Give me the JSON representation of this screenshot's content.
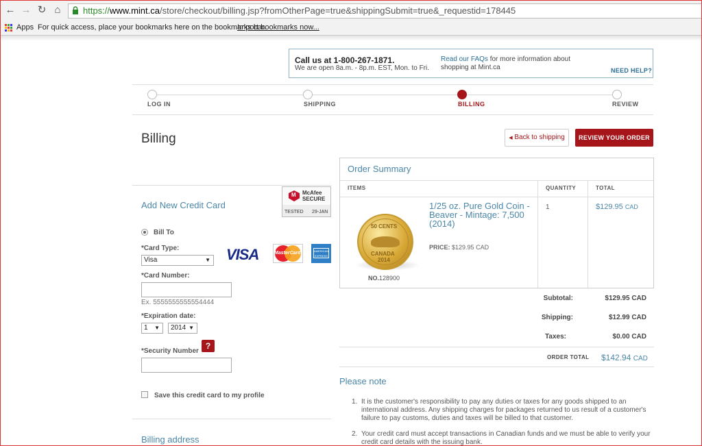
{
  "browser": {
    "url_scheme": "https://",
    "url_host": "www.mint.ca",
    "url_path": "/store/checkout/billing.jsp?fromOtherPage=true&shippingSubmit=true&_requestid=178445",
    "apps_label": "Apps",
    "bookmarks_hint": "For quick access, place your bookmarks here on the bookmarks bar.",
    "import_link": "Import bookmarks now..."
  },
  "help": {
    "call_title": "Call us at 1-800-267-1871.",
    "call_hours": "We are open 8a.m. - 8p.m. EST, Mon. to Fri.",
    "faq_link": "Read our FAQs",
    "faq_rest": " for more information about shopping at Mint.ca",
    "need_help": "NEED HELP?"
  },
  "steps": [
    {
      "label": "LOG IN"
    },
    {
      "label": "SHIPPING"
    },
    {
      "label": "BILLING"
    },
    {
      "label": "REVIEW"
    }
  ],
  "header": {
    "title": "Billing",
    "back_label": "Back to shipping",
    "review_label": "REVIEW YOUR ORDER"
  },
  "form": {
    "section_title": "Add New Credit Card",
    "mcafee_name": "McAfee SECURE",
    "mcafee_tested": "TESTED",
    "mcafee_date": "29-JAN",
    "bill_to": "Bill To",
    "card_type_label": "*Card Type:",
    "card_type_value": "Visa",
    "card_number_label": "*Card Number:",
    "card_number_value": "",
    "card_number_hint": "Ex. 5555555555554444",
    "expiration_label": "*Expiration date:",
    "exp_month": "1",
    "exp_year": "2014",
    "security_label": "*Security Number",
    "security_help": "?",
    "save_card_label": "Save this credit card to my profile",
    "billing_address_title": "Billing address",
    "visa_logo": "VISA",
    "mastercard_logo": "MasterCard",
    "amex_logo": "AMERICAN EXPRESS"
  },
  "order_summary": {
    "title": "Order Summary",
    "columns": {
      "items": "ITEMS",
      "quantity": "QUANTITY",
      "total": "TOTAL"
    },
    "item": {
      "coin_top": "50 CENTS",
      "coin_country": "CANADA",
      "coin_year": "2014",
      "number_label": "NO.",
      "number": "128900",
      "name": "1/25 oz. Pure Gold Coin - Beaver - Mintage: 7,500 (2014)",
      "price_label": "PRICE:",
      "price": "$129.95 CAD",
      "quantity": "1",
      "total": "$129.95",
      "total_currency": "CAD"
    },
    "subtotal_label": "Subtotal:",
    "subtotal": "$129.95 CAD",
    "shipping_label": "Shipping:",
    "shipping": "$12.99 CAD",
    "taxes_label": "Taxes:",
    "taxes": "$0.00 CAD",
    "order_total_label": "ORDER TOTAL",
    "order_total": "$142.94",
    "order_total_currency": "CAD"
  },
  "notes": {
    "title": "Please note",
    "items": [
      {
        "num": "1.",
        "text": "It is the customer's responsibility to pay any duties or taxes for any goods shipped to an international address. Any shipping charges for packages returned to us result of a customer's failure to pay customs, duties and taxes will be billed to that customer."
      },
      {
        "num": "2.",
        "text": "Your credit card must accept transactions in Canadian funds and we must be able to verify your credit card details with the issuing bank."
      }
    ]
  }
}
